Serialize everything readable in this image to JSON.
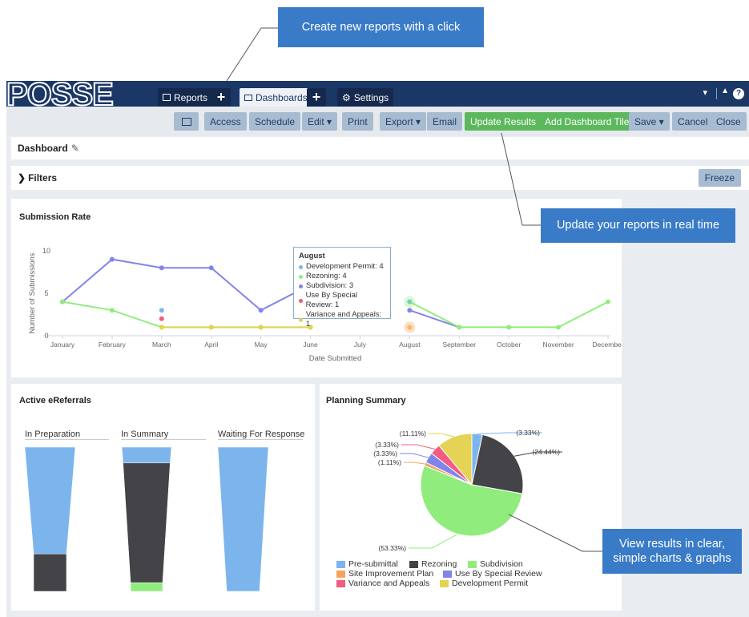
{
  "callouts": {
    "create": "Create new reports with a click",
    "update": "Update your reports in real time",
    "view": "View results in clear, simple charts & graphs"
  },
  "logo": "POSSE",
  "nav": {
    "reports": "Reports",
    "dashboards": "Dashboards",
    "settings": "Settings",
    "plus": "+",
    "dropdown": "▾",
    "bell": "🔔",
    "help": "?"
  },
  "toolbar": {
    "present_icon": "presentation-icon",
    "access": "Access",
    "schedule": "Schedule",
    "edit": "Edit ▾",
    "print": "Print",
    "export": "Export ▾",
    "email": "Email",
    "update_results": "Update Results",
    "add_tile": "Add Dashboard Tile",
    "save": "Save ▾",
    "cancel": "Cancel",
    "close": "Close"
  },
  "dashboard": {
    "title": "Dashboard"
  },
  "filters": {
    "label": "Filters",
    "freeze": "Freeze"
  },
  "colors": {
    "development_permit": "#7cb5ec",
    "rezoning": "#90ed7d",
    "subdivision": "#8085e9",
    "use_by_special_review": "#f15c80",
    "variance_and_appeals": "#e4d354",
    "pre_submittal": "#7cb5ec",
    "rezoning_pie": "#434348",
    "site_improvement_plan": "#f7a35c"
  },
  "submission": {
    "title": "Submission Rate",
    "tooltip": {
      "title": "August",
      "rows": [
        {
          "label": "Development Permit: 4",
          "color": "#7cb5ec"
        },
        {
          "label": "Rezoning: 4",
          "color": "#90ed7d"
        },
        {
          "label": "Subdivision: 3",
          "color": "#8085e9"
        },
        {
          "label": "Use By Special Review: 1",
          "color": "#f15c80"
        },
        {
          "label": "Variance and Appeals: 1",
          "color": "#e4d354"
        }
      ]
    }
  },
  "ereferrals": {
    "title": "Active eReferrals",
    "columns": [
      "In Preparation",
      "In Summary",
      "Waiting For Response"
    ]
  },
  "planning": {
    "title": "Planning Summary"
  },
  "chart_data": [
    {
      "type": "line",
      "title": "Submission Rate",
      "xlabel": "Date Submitted",
      "ylabel": "Number of Submissions",
      "ylim": [
        0,
        10
      ],
      "yticks": [
        "0",
        "5",
        "10"
      ],
      "categories": [
        "January",
        "February",
        "March",
        "April",
        "May",
        "June",
        "July",
        "August",
        "September",
        "October",
        "November",
        "December"
      ],
      "series": [
        {
          "name": "Subdivision",
          "color": "#8085e9",
          "values": [
            4,
            9,
            8,
            8,
            3,
            6,
            null,
            3,
            1,
            null,
            null,
            null
          ]
        },
        {
          "name": "Rezoning",
          "color": "#90ed7d",
          "values": [
            4,
            3,
            1,
            1,
            1,
            1,
            null,
            4,
            1,
            1,
            1,
            4
          ]
        },
        {
          "name": "Development Permit",
          "color": "#7cb5ec",
          "values": [
            null,
            null,
            3,
            null,
            null,
            1,
            null,
            4,
            null,
            null,
            null,
            null
          ]
        },
        {
          "name": "Use By Special Review",
          "color": "#f15c80",
          "values": [
            null,
            null,
            2,
            null,
            null,
            null,
            null,
            1,
            null,
            null,
            null,
            null
          ]
        },
        {
          "name": "Variance and Appeals",
          "color": "#e4d354",
          "values": [
            null,
            null,
            1,
            1,
            1,
            1,
            null,
            1,
            null,
            null,
            null,
            null
          ]
        }
      ]
    },
    {
      "type": "bar",
      "title": "Active eReferrals",
      "categories": [
        "In Preparation",
        "In Summary",
        "Waiting For Response"
      ],
      "series": [
        {
          "color": "#7cb5ec",
          "values": [
            0.74,
            0.11,
            1.0
          ]
        },
        {
          "color": "#434348",
          "values": [
            0.26,
            0.83,
            0
          ]
        },
        {
          "color": "#90ed7d",
          "values": [
            0,
            0.06,
            0
          ]
        }
      ]
    },
    {
      "type": "pie",
      "title": "Planning Summary",
      "legend_position": "bottom",
      "slices": [
        {
          "name": "Pre-submittal",
          "label": "(3.33%)",
          "value": 3.33,
          "color": "#7cb5ec"
        },
        {
          "name": "Rezoning",
          "label": "(24.44%)",
          "value": 24.44,
          "color": "#434348"
        },
        {
          "name": "Subdivision",
          "label": "(53.33%)",
          "value": 53.33,
          "color": "#90ed7d"
        },
        {
          "name": "Site Improvement Plan",
          "label": "(1.11%)",
          "value": 1.11,
          "color": "#f7a35c"
        },
        {
          "name": "Use By Special Review",
          "label": "(3.33%)",
          "value": 3.33,
          "color": "#8085e9"
        },
        {
          "name": "Variance and Appeals",
          "label": "(3.33%)",
          "value": 3.33,
          "color": "#f15c80"
        },
        {
          "name": "Development Permit",
          "label": "(11.11%)",
          "value": 11.11,
          "color": "#e4d354"
        }
      ]
    }
  ]
}
